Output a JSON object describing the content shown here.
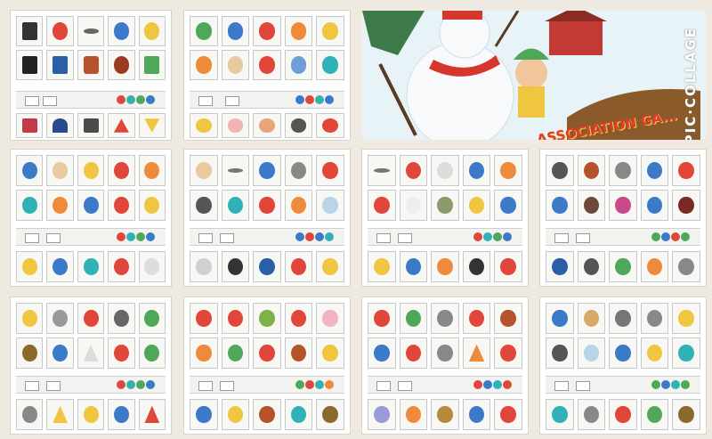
{
  "collage": {
    "watermark": "PIC·COLLAGE",
    "hero_banner_text": "ASSOCIATION GA..."
  },
  "colors": {
    "background": "#eeeae2",
    "panel": "#ffffff",
    "red": "#e0473a",
    "blue": "#3b79c9",
    "green": "#4fa85a",
    "yellow": "#f0c540",
    "orange": "#f08a3b",
    "teal": "#2fb1b5"
  }
}
